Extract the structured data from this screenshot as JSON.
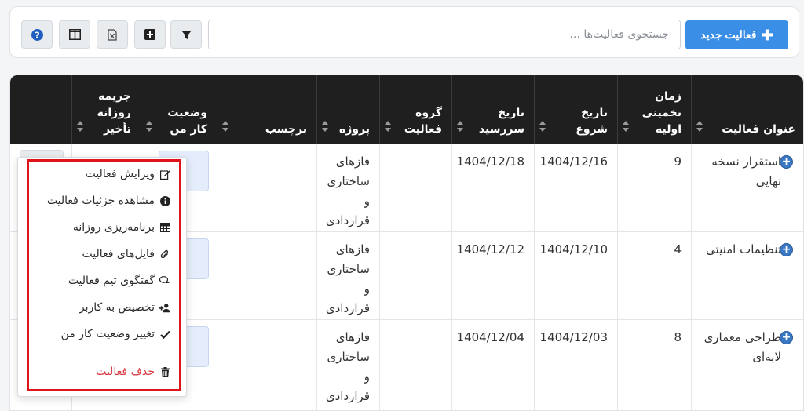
{
  "toolbar": {
    "new_button_label": "فعالیت جدید",
    "new_button_icon": "plus-icon",
    "search_placeholder": "جستجوی فعالیت‌ها ...",
    "tools": [
      "filter-icon",
      "add-square-icon",
      "excel-export-icon",
      "columns-icon",
      "help-icon"
    ],
    "accent_color": "#3a8ee6"
  },
  "table": {
    "columns": [
      {
        "label": "عنوان فعالیت"
      },
      {
        "label": "زمان تخمینی اولیه"
      },
      {
        "label": "تاریخ شروع"
      },
      {
        "label": "تاریخ سررسید"
      },
      {
        "label": "گروه فعالیت"
      },
      {
        "label": "پروژه"
      },
      {
        "label": "برچسب"
      },
      {
        "label": "وضعیت کار من"
      },
      {
        "label": "جریمه روزانه تأخیر"
      }
    ],
    "header_bg": "#1f1f1f",
    "rows": [
      {
        "title": "استقرار نسخه نهایی",
        "estimate": "9",
        "start": "1404/12/16",
        "due": "1404/12/18",
        "group": "",
        "project": "فازهای ساختاری و قراردادی",
        "tag": ""
      },
      {
        "title": "تنظیمات امنیتی",
        "estimate": "4",
        "start": "1404/12/10",
        "due": "1404/12/12",
        "group": "",
        "project": "فازهای ساختاری و قراردادی",
        "tag": ""
      },
      {
        "title": "طراحی معماری لایه‌ای",
        "estimate": "8",
        "start": "1404/12/03",
        "due": "1404/12/04",
        "group": "",
        "project": "فازهای ساختاری و قراردادی",
        "tag": ""
      }
    ]
  },
  "menu": {
    "items": [
      {
        "label": "ویرایش فعالیت",
        "icon": "edit-icon"
      },
      {
        "label": "مشاهده جزئیات فعالیت",
        "icon": "info-icon"
      },
      {
        "label": "برنامه‌ریزی روزانه",
        "icon": "table-icon"
      },
      {
        "label": "فایل‌های فعالیت",
        "icon": "paperclip-icon"
      },
      {
        "label": "گفتگوی تیم فعالیت",
        "icon": "chat-icon"
      },
      {
        "label": "تخصیص به کاربر",
        "icon": "user-plus-icon"
      },
      {
        "label": "تغییر وضعیت کار من",
        "icon": "check-icon"
      }
    ],
    "delete": {
      "label": "حذف فعالیت",
      "icon": "trash-icon"
    },
    "highlight_color": "#e0151b",
    "danger_color": "#d9363e"
  }
}
